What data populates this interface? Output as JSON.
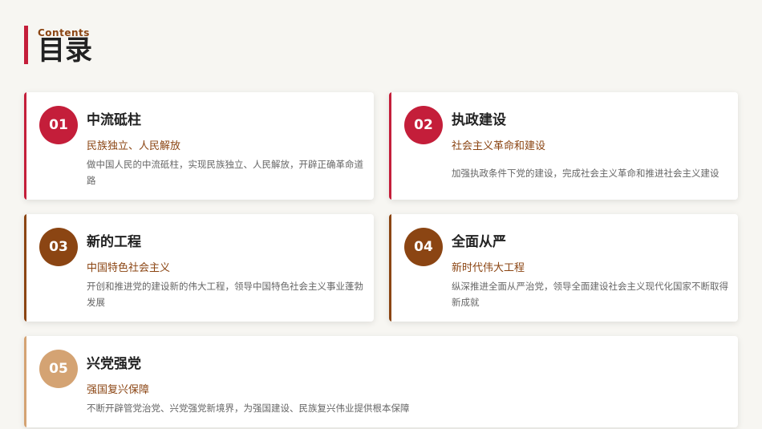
{
  "header": {
    "subtitle": "Contents",
    "title": "目录"
  },
  "colors": {
    "red": "#c41e3a",
    "brown": "#8b4513",
    "tan": "#d4a373"
  },
  "items": [
    {
      "num": "01",
      "title": "中流砥柱",
      "subtitle": "民族独立、人民解放",
      "desc": "做中国人民的中流砥柱，实现民族独立、人民解放，开辟正确革命道路"
    },
    {
      "num": "02",
      "title": "执政建设",
      "subtitle": "社会主义革命和建设",
      "desc": "加强执政条件下党的建设，完成社会主义革命和推进社会主义建设"
    },
    {
      "num": "03",
      "title": "新的工程",
      "subtitle": "中国特色社会主义",
      "desc": "开创和推进党的建设新的伟大工程，领导中国特色社会主义事业蓬勃发展"
    },
    {
      "num": "04",
      "title": "全面从严",
      "subtitle": "新时代伟大工程",
      "desc": "纵深推进全面从严治党，领导全面建设社会主义现代化国家不断取得新成就"
    },
    {
      "num": "05",
      "title": "兴党强党",
      "subtitle": "强国复兴保障",
      "desc": "不断开辟管党治党、兴党强党新境界，为强国建设、民族复兴伟业提供根本保障"
    }
  ]
}
